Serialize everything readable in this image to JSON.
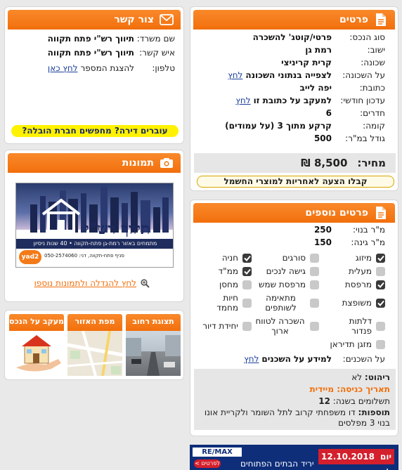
{
  "contact": {
    "title": "צור קשר",
    "name_label": "שם משרד:",
    "name_value": "תיווך רש\"י פתח תקווה",
    "person_label": "איש קשר:",
    "person_value": "תיווך רש\"י פתח תקווה",
    "phone_label": "טלפון:",
    "phone_text": "להצגת המספר",
    "phone_link": "לחץ כאן",
    "moving_banner": "עוברים דירה? מחפשים חברת הובלה?"
  },
  "photos": {
    "title": "תמונות",
    "banner_title": "תיווך רש\"י",
    "banner_tagline": "מתמחים באזור רמת-גן פתח-תקווה • 40 שנות ניסיון",
    "banner_footer": "סניף פתח-תקווה, דני: 050-2574060",
    "banner_logo": "yad2",
    "enlarge_link": "לחץ להגדלה ולתמונות נוספו"
  },
  "thumbs": [
    {
      "label": "תצוגת רחוב",
      "icon": "street-view"
    },
    {
      "label": "מפת האזור",
      "icon": "map"
    },
    {
      "label": "מעקב על הנכס",
      "icon": "house-in-hand"
    }
  ],
  "details": {
    "title": "פרטים",
    "rows": [
      {
        "label": "סוג הנכס:",
        "value": "פרטי/קוטג' להשכרה"
      },
      {
        "label": "ישוב:",
        "value": "רמת גן"
      },
      {
        "label": "שכונה:",
        "value": "קרית קריניצי"
      },
      {
        "label": "על השכונה:",
        "value": "לצפייה בנתוני השכונה",
        "link": "לחץ"
      },
      {
        "label": "כתובת:",
        "value": "יפה לייב"
      },
      {
        "label": "עדכון חודשי:",
        "value": "למעקב על כתובת זו",
        "link": "לחץ"
      },
      {
        "label": "חדרים:",
        "value": "6"
      },
      {
        "label": "קומה:",
        "value": "קרקע מתוך 3 (על עמודים)"
      },
      {
        "label": "גודל במ\"ר:",
        "value": "500"
      }
    ],
    "price_label": "מחיר:",
    "price_value": "8,500 ₪",
    "offer_banner": "קבלו הצעה לאחריות למוצרי החשמל"
  },
  "more": {
    "title": "פרטים נוספים",
    "built_label": "מ\"ר בנוי:",
    "built_value": "250",
    "garden_label": "מ\"ר גינה:",
    "garden_value": "150",
    "features": [
      {
        "label": "מיזוג",
        "on": true
      },
      {
        "label": "סורגים",
        "on": false
      },
      {
        "label": "חניה",
        "on": true
      },
      {
        "label": "מעלית",
        "on": false
      },
      {
        "label": "גישה לנכים",
        "on": false
      },
      {
        "label": "ממ\"ד",
        "on": true
      },
      {
        "label": "מרפסת",
        "on": true
      },
      {
        "label": "מרפסת שמש",
        "on": false
      },
      {
        "label": "מחסן",
        "on": false
      },
      {
        "label": "משופצת",
        "on": true
      },
      {
        "label": "מתאימה לשותפים",
        "on": false
      },
      {
        "label": "חיות מחמד",
        "on": false
      },
      {
        "label": "דלתות פנדור",
        "on": false
      },
      {
        "label": "השכרה לטווח ארוך",
        "on": false
      },
      {
        "label": "יחידת דיור",
        "on": false
      },
      {
        "label": "מזגן תדיראן",
        "on": false
      }
    ],
    "landlords_label": "על השכנים:",
    "landlords_text": "למידע על השכנים",
    "landlords_link": "לחץ",
    "furniture_label": "ריהוט:",
    "furniture_value": "לא",
    "entry_label": "תאריך כניסה:",
    "entry_value": "מיידית",
    "payments_label": "תשלומים בשנה:",
    "payments_value": "12",
    "extras_label": "תוספות:",
    "extras_value": "דו משפחתי קרוב לתל השומר ולקריית אונו בנוי 3 מפלסים"
  },
  "ad": {
    "brand": "RE/MAX",
    "day": "יום ו'",
    "date": "12.10.2018",
    "text": "יריד הבתים הפתוחים",
    "more": "לפרטים >"
  }
}
